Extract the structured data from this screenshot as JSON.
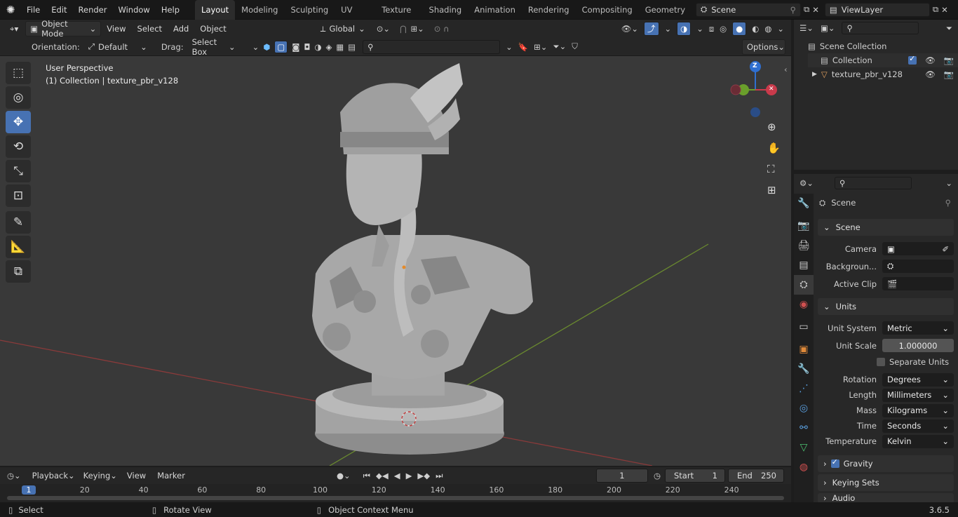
{
  "topbar": {
    "menus": [
      "File",
      "Edit",
      "Render",
      "Window",
      "Help"
    ],
    "tabs": [
      "Layout",
      "Modeling",
      "Sculpting",
      "UV Editing",
      "Texture Paint",
      "Shading",
      "Animation",
      "Rendering",
      "Compositing",
      "Geometry Noc"
    ],
    "active_tab": "Layout",
    "scene_name": "Scene",
    "view_layer": "ViewLayer"
  },
  "viewport_header": {
    "mode": "Object Mode",
    "menus": [
      "View",
      "Select",
      "Add",
      "Object"
    ],
    "transform_orientation": "Global"
  },
  "tool_header": {
    "orientation_label": "Orientation:",
    "orientation_value": "Default",
    "drag_label": "Drag:",
    "drag_value": "Select Box",
    "options_label": "Options"
  },
  "viewport": {
    "perspective": "User Perspective",
    "collection_info": "(1) Collection | texture_pbr_v128",
    "gizmo_z": "Z"
  },
  "outliner": {
    "root": "Scene Collection",
    "collection": "Collection",
    "object": "texture_pbr_v128"
  },
  "properties": {
    "header": "Scene",
    "scene_panel": {
      "title": "Scene",
      "camera_label": "Camera",
      "background_label": "Backgroun...",
      "active_clip_label": "Active Clip"
    },
    "units_panel": {
      "title": "Units",
      "unit_system_label": "Unit System",
      "unit_system": "Metric",
      "unit_scale_label": "Unit Scale",
      "unit_scale": "1.000000",
      "separate_units": "Separate Units",
      "rotation_label": "Rotation",
      "rotation": "Degrees",
      "length_label": "Length",
      "length": "Millimeters",
      "mass_label": "Mass",
      "mass": "Kilograms",
      "time_label": "Time",
      "time": "Seconds",
      "temperature_label": "Temperature",
      "temperature": "Kelvin"
    },
    "gravity": "Gravity",
    "keying_sets": "Keying Sets",
    "audio": "Audio"
  },
  "timeline": {
    "menus": [
      "Playback",
      "Keying",
      "View",
      "Marker"
    ],
    "current_frame": "1",
    "start_label": "Start",
    "start": "1",
    "end_label": "End",
    "end": "250",
    "ruler_marks": [
      "1",
      "20",
      "40",
      "60",
      "80",
      "100",
      "120",
      "140",
      "160",
      "180",
      "200",
      "220",
      "240"
    ]
  },
  "statusbar": {
    "select": "Select",
    "rotate": "Rotate View",
    "context": "Object Context Menu",
    "version": "3.6.5"
  }
}
